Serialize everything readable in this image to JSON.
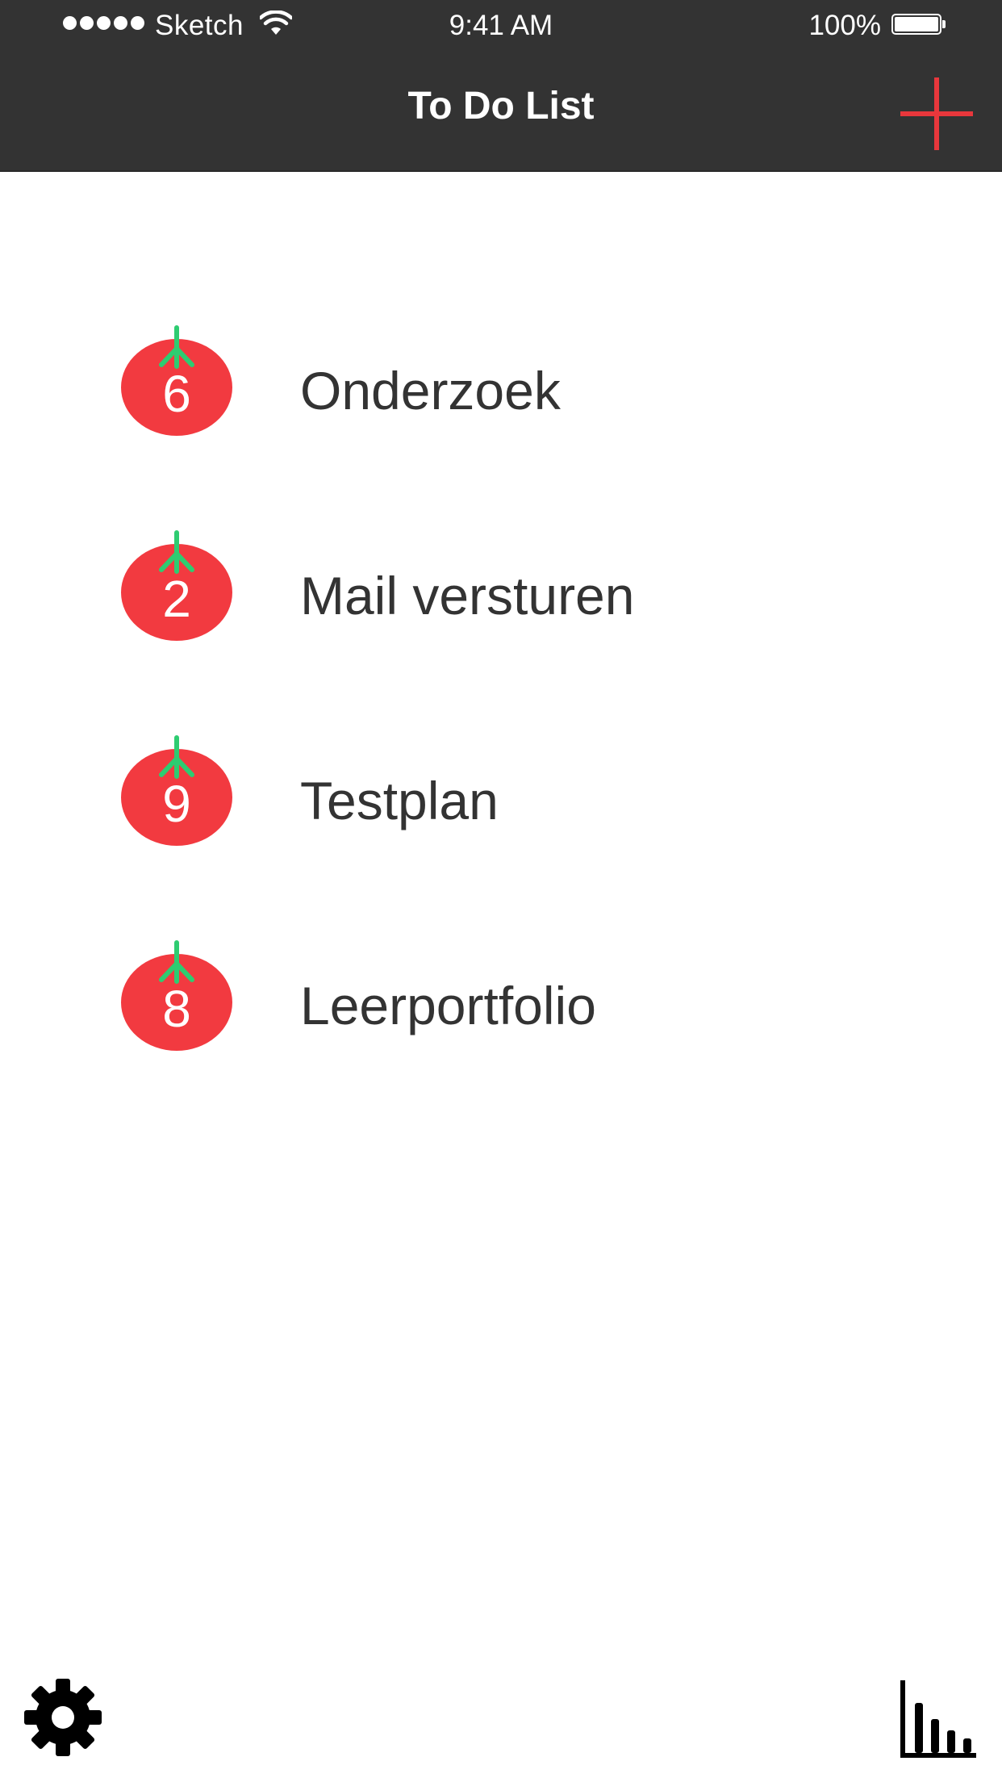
{
  "status_bar": {
    "carrier": "Sketch",
    "time": "9:41 AM",
    "battery": "100%"
  },
  "header": {
    "title": "To Do List",
    "add_icon": "plus-icon"
  },
  "tasks": [
    {
      "count": "6",
      "label": "Onderzoek"
    },
    {
      "count": "2",
      "label": "Mail versturen"
    },
    {
      "count": "9",
      "label": "Testplan"
    },
    {
      "count": "8",
      "label": "Leerportfolio"
    }
  ],
  "toolbar": {
    "settings_icon": "gear-icon",
    "stats_icon": "bar-chart-icon"
  },
  "colors": {
    "header_bg": "#333333",
    "accent_red": "#e8373c",
    "tomato_red": "#f23a40",
    "stem_green": "#2ecc71",
    "text_dark": "#333333"
  }
}
